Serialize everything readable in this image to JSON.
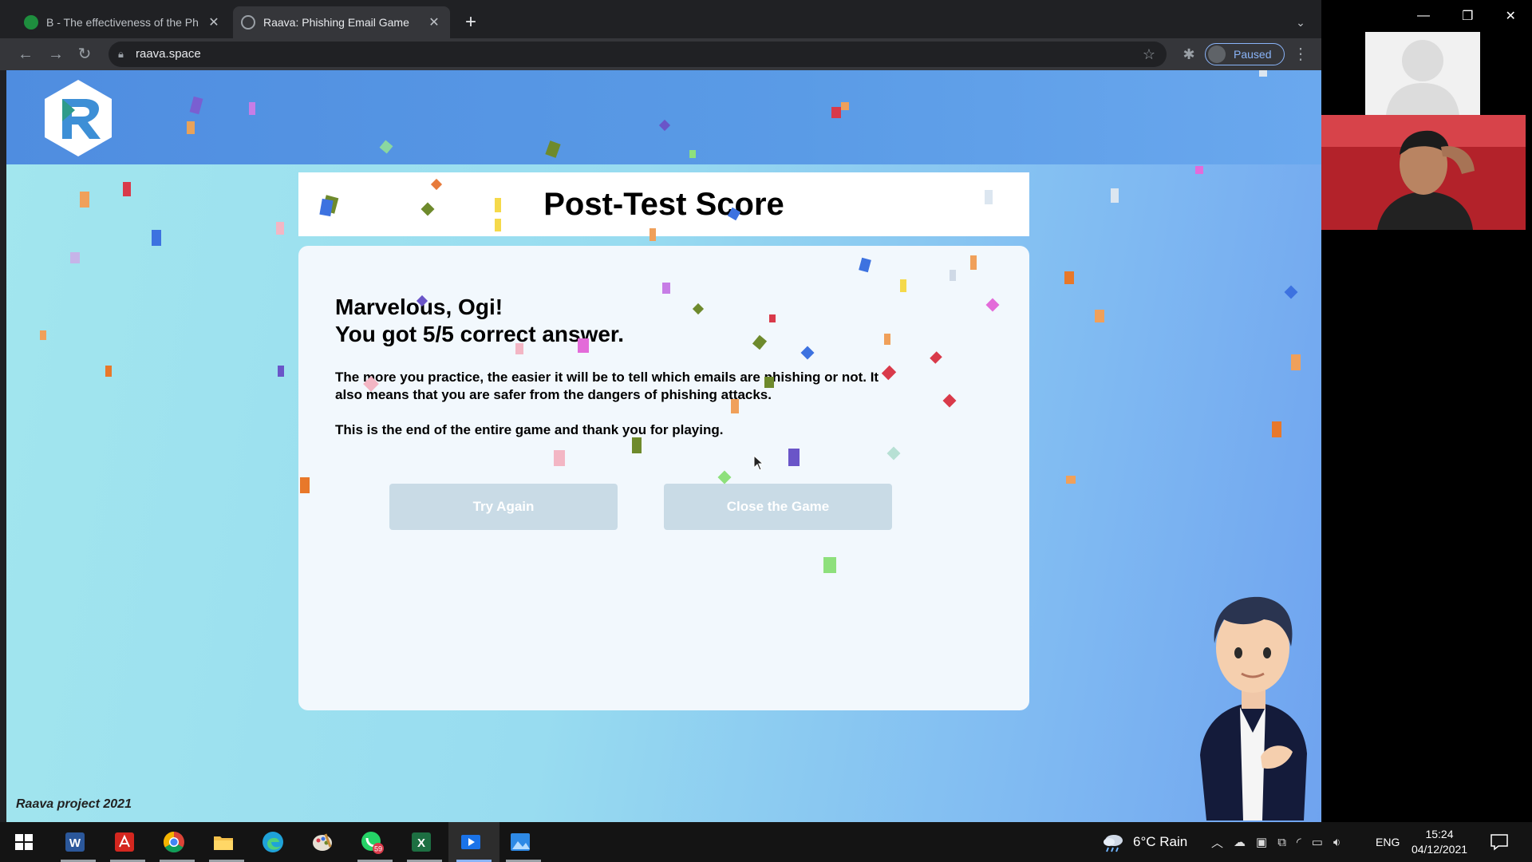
{
  "browser": {
    "tabs": [
      {
        "title": "B - The effectiveness of the Ph",
        "active": false,
        "icon": "green-app-favicon"
      },
      {
        "title": "Raava: Phishing Email Game",
        "active": true,
        "icon": "globe-favicon"
      }
    ],
    "url": "raava.space",
    "profile_label": "Paused"
  },
  "page": {
    "header_title": "Post-Test Score",
    "greeting": "Marvelous, Ogi!",
    "score_line": "You got 5/5 correct answer.",
    "paragraph_1": "The more you practice, the easier it will be to tell which emails are phishing or not. It also means that you are safer from the dangers of phishing attacks.",
    "paragraph_2": "This is the end of the entire game and thank you for playing.",
    "buttons": {
      "try_again": "Try Again",
      "close_game": "Close the Game"
    },
    "footer": "Raava project 2021",
    "colors": {
      "header_bar": "#5a9be6",
      "button_bg": "#c9dbe6",
      "card_bg": "#f2f8fd"
    }
  },
  "taskbar": {
    "apps": [
      "windows-start",
      "word",
      "acrobat",
      "chrome",
      "file-explorer",
      "edge",
      "paint",
      "whatsapp",
      "excel",
      "video-player",
      "photos"
    ],
    "whatsapp_badge": "59",
    "weather": "6°C Rain",
    "language": "ENG",
    "time": "15:24",
    "date": "04/12/2021"
  }
}
